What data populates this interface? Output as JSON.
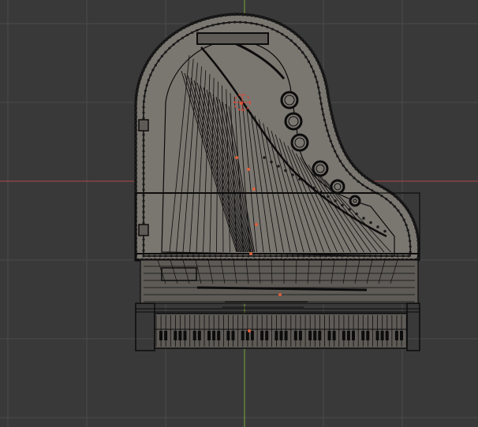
{
  "viewport": {
    "background": "#393939",
    "grid_color": "#4a4a4a",
    "x_axis_color": "#b04848",
    "y_axis_color": "#7aa83a",
    "wire_color": "#0c0c0c",
    "fill_color": "#7a7670",
    "fill_dark": "#5e5b57",
    "vertex_color": "#1a1a1a",
    "cursor_color": "#d84a3a",
    "origin_color": "#e0603a"
  },
  "object": {
    "type": "mesh",
    "subject_icon": "grand-piano-wireframe-icon",
    "view": "top-orthographic",
    "display": "wireframe-overlay"
  }
}
